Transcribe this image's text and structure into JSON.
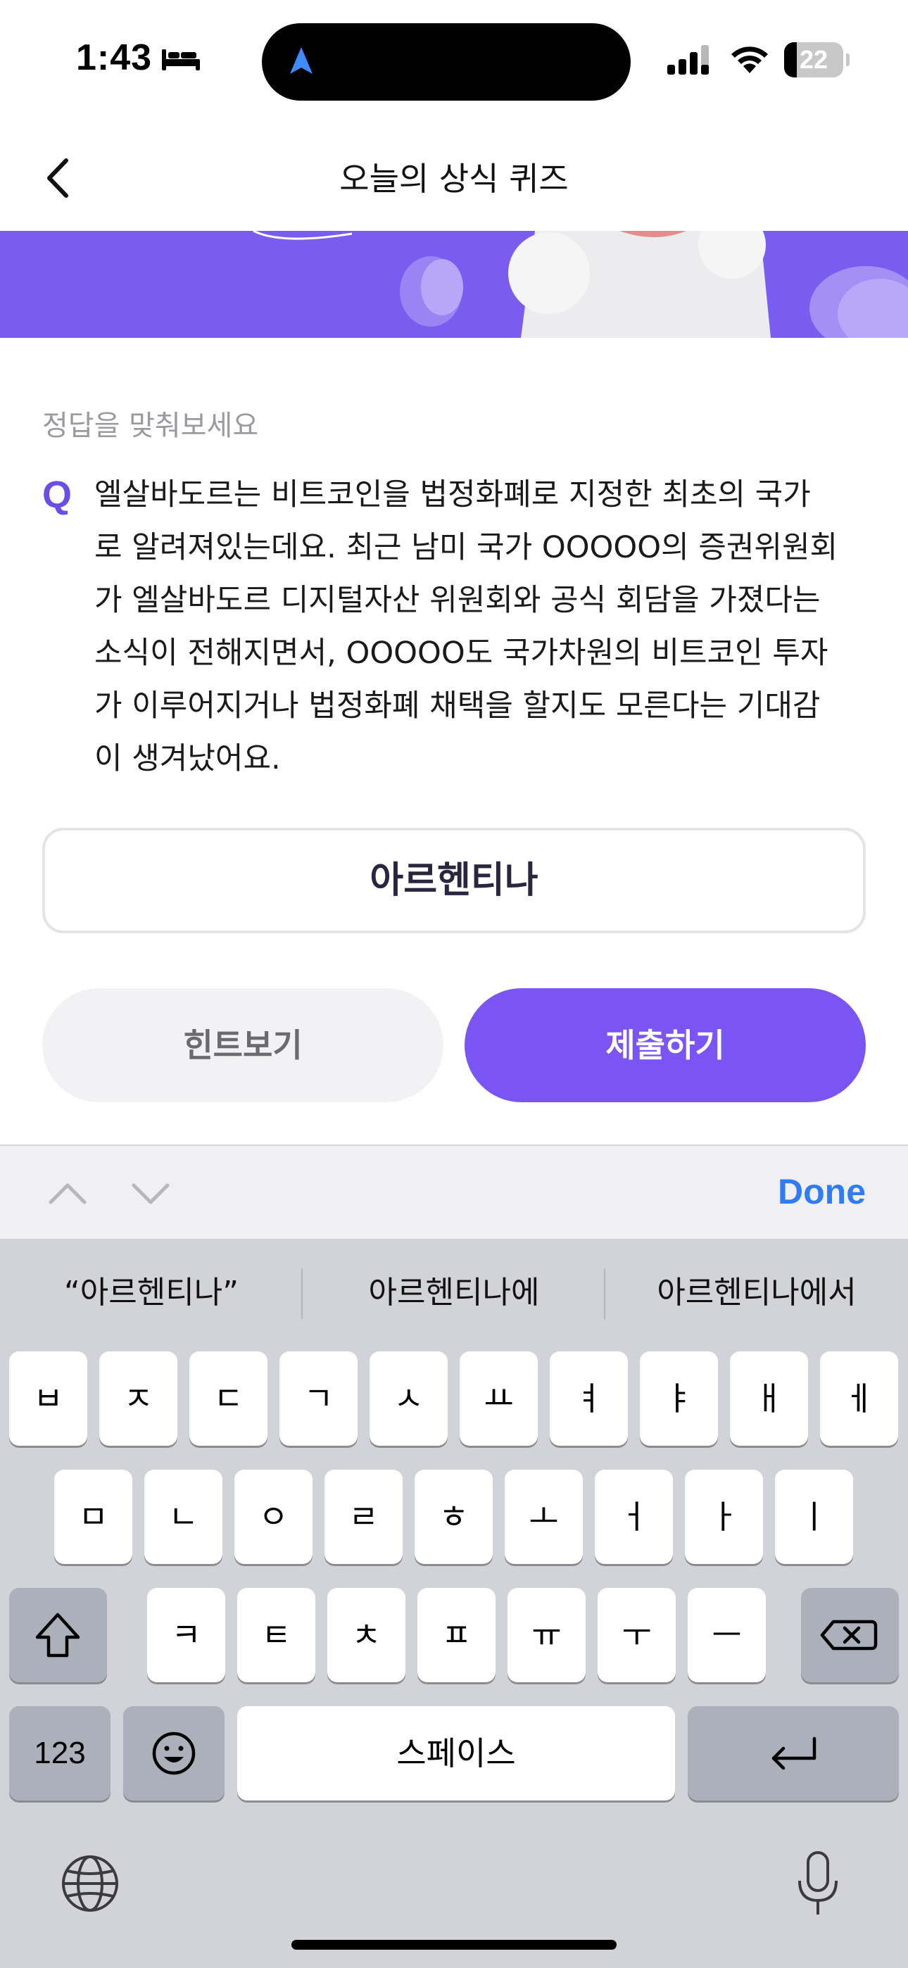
{
  "status_bar": {
    "time": "1:43",
    "battery_level": "22",
    "battery_fraction": 0.22,
    "icons": [
      "bed-icon",
      "location-arrow-icon",
      "signal-icon",
      "wifi-icon",
      "battery-icon"
    ]
  },
  "header": {
    "title": "오늘의 상식 퀴즈",
    "back_icon": "chevron-left-icon"
  },
  "banner": {
    "color": "#7a5cf0"
  },
  "quiz": {
    "label": "정답을 맞춰보세요",
    "q_mark": "Q",
    "question": "엘살바도르는 비트코인을 법정화폐로 지정한 최초의 국가로 알려져있는데요. 최근 남미 국가 OOOOO의 증권위원회가 엘살바도르 디지털자산 위원회와 공식 회담을 가졌다는 소식이 전해지면서, OOOOO도 국가차원의 비트코인 투자가 이루어지거나 법정화폐 채택을 할지도 모른다는 기대감이 생겨났어요.",
    "question_lines": [
      "엘살바도르는 비트코인을 법정화폐로 지정한 최초의 국가",
      "로 알려져있는데요. 최근 남미 국가 OOOOO의 증권위원회",
      "가 엘살바도르 디지털자산 위원회와 공식 회담을 가졌다는",
      "소식이 전해지면서, OOOOO도 국가차원의 비트코인 투자",
      "가 이루어지거나 법정화폐 채택을 할지도 모른다는 기대감",
      "이 생겨났어요."
    ],
    "answer_value": "아르헨티나",
    "hint_label": "힌트보기",
    "submit_label": "제출하기",
    "accent_color": "#7a55f4"
  },
  "accessory": {
    "done_label": "Done",
    "prev_icon": "chevron-up-icon",
    "next_icon": "chevron-down-icon"
  },
  "keyboard": {
    "suggestions": [
      "“아르헨티나”",
      "아르헨티나에",
      "아르헨티나에서"
    ],
    "row1": [
      "ㅂ",
      "ㅈ",
      "ㄷ",
      "ㄱ",
      "ㅅ",
      "ㅛ",
      "ㅕ",
      "ㅑ",
      "ㅐ",
      "ㅔ"
    ],
    "row2": [
      "ㅁ",
      "ㄴ",
      "ㅇ",
      "ㄹ",
      "ㅎ",
      "ㅗ",
      "ㅓ",
      "ㅏ",
      "ㅣ"
    ],
    "row3": [
      "ㅋ",
      "ㅌ",
      "ㅊ",
      "ㅍ",
      "ㅠ",
      "ㅜ",
      "ㅡ"
    ],
    "numbers_label": "123",
    "space_label": "스페이스",
    "shift_icon": "shift-icon",
    "delete_icon": "delete-icon",
    "emoji_icon": "emoji-icon",
    "return_icon": "return-icon",
    "globe_icon": "globe-icon",
    "mic_icon": "microphone-icon"
  }
}
